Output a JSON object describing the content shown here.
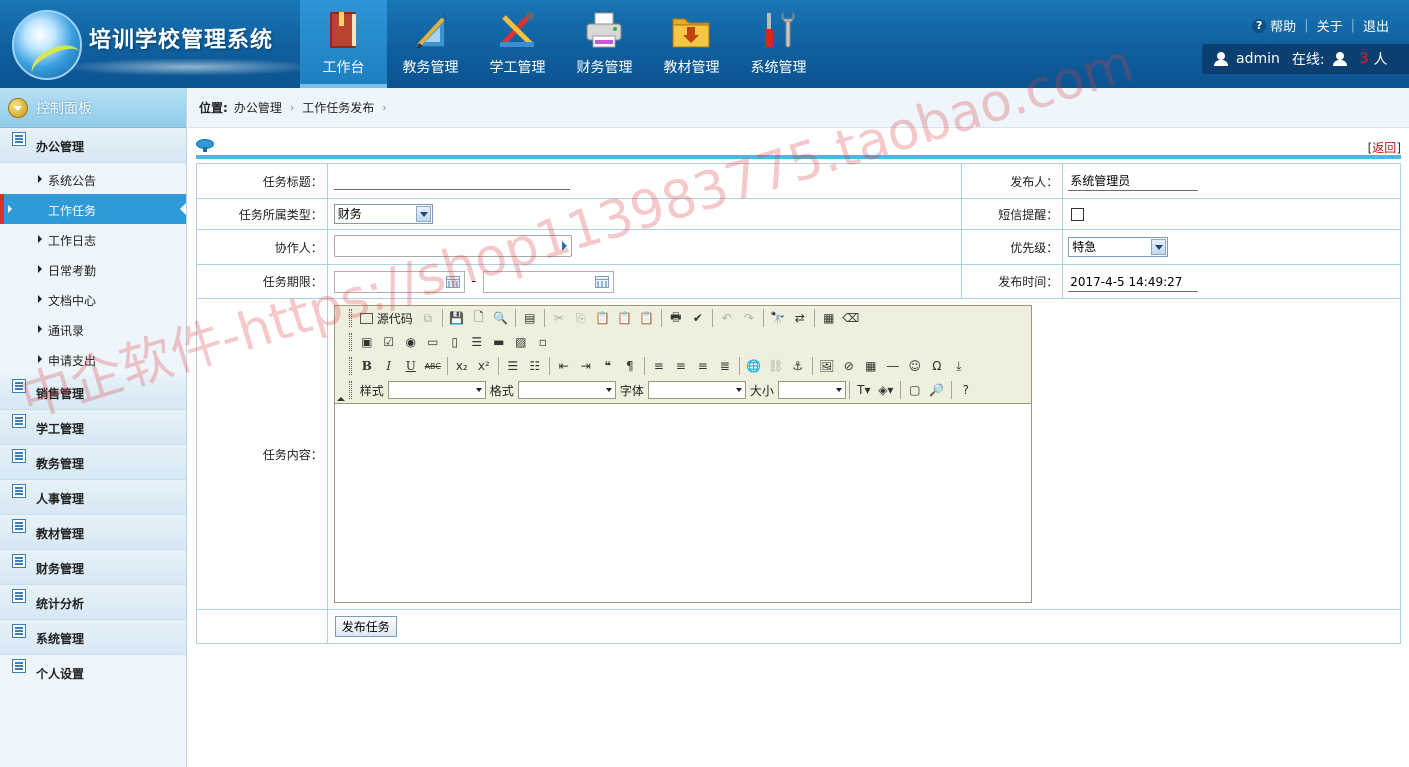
{
  "app": {
    "title": "培训学校管理系统"
  },
  "nav": {
    "items": [
      {
        "label": "工作台",
        "icon": "book-icon",
        "active": true
      },
      {
        "label": "教务管理",
        "icon": "ruler-icon",
        "active": false
      },
      {
        "label": "学工管理",
        "icon": "tools-icon",
        "active": false
      },
      {
        "label": "财务管理",
        "icon": "printer-icon",
        "active": false
      },
      {
        "label": "教材管理",
        "icon": "folder-download-icon",
        "active": false
      },
      {
        "label": "系统管理",
        "icon": "wrench-screwdriver-icon",
        "active": false
      }
    ]
  },
  "top_links": {
    "help": "帮助",
    "about": "关于",
    "logout": "退出"
  },
  "user_bar": {
    "username": "admin",
    "online_label": "在线:",
    "online_count": "3",
    "online_unit": "人"
  },
  "sidebar": {
    "header": "控制面板",
    "office_group": "办公管理",
    "office_items": [
      {
        "label": "系统公告",
        "active": false
      },
      {
        "label": "工作任务",
        "active": true
      },
      {
        "label": "工作日志",
        "active": false
      },
      {
        "label": "日常考勤",
        "active": false
      },
      {
        "label": "文档中心",
        "active": false
      },
      {
        "label": "通讯录",
        "active": false
      },
      {
        "label": "申请支出",
        "active": false
      }
    ],
    "groups": [
      "销售管理",
      "学工管理",
      "教务管理",
      "人事管理",
      "教材管理",
      "财务管理",
      "统计分析",
      "系统管理",
      "个人设置"
    ]
  },
  "breadcrumb": {
    "label": "位置:",
    "items": [
      "办公管理",
      "工作任务发布"
    ],
    "separator": "›"
  },
  "page": {
    "back_label": "返回",
    "back_open": "[",
    "back_close": "]"
  },
  "form": {
    "title_label": "任务标题：",
    "title_value": "",
    "publisher_label": "发布人：",
    "publisher_value": "系统管理员",
    "type_label": "任务所属类型：",
    "type_value": "财务",
    "sms_label": "短信提醒：",
    "sms_checked": false,
    "collaborator_label": "协作人：",
    "collaborator_value": "",
    "priority_label": "优先级：",
    "priority_value": "特急",
    "deadline_label": "任务期限：",
    "deadline_start": "",
    "deadline_sep": "-",
    "deadline_end": "",
    "publish_time_label": "发布时间：",
    "publish_time_value": "2017-4-5 14:49:27",
    "content_label": "任务内容：",
    "submit_label": "发布任务"
  },
  "editor": {
    "source_label": "源代码",
    "style_label": "样式",
    "format_label": "格式",
    "font_label": "字体",
    "size_label": "大小",
    "content": ""
  },
  "watermark": "中企软件-https://shop113983775.taobao.com",
  "colors": {
    "header_blue": "#0f5f9e",
    "accent_blue": "#2e9ad8",
    "link_red": "#c01010"
  }
}
